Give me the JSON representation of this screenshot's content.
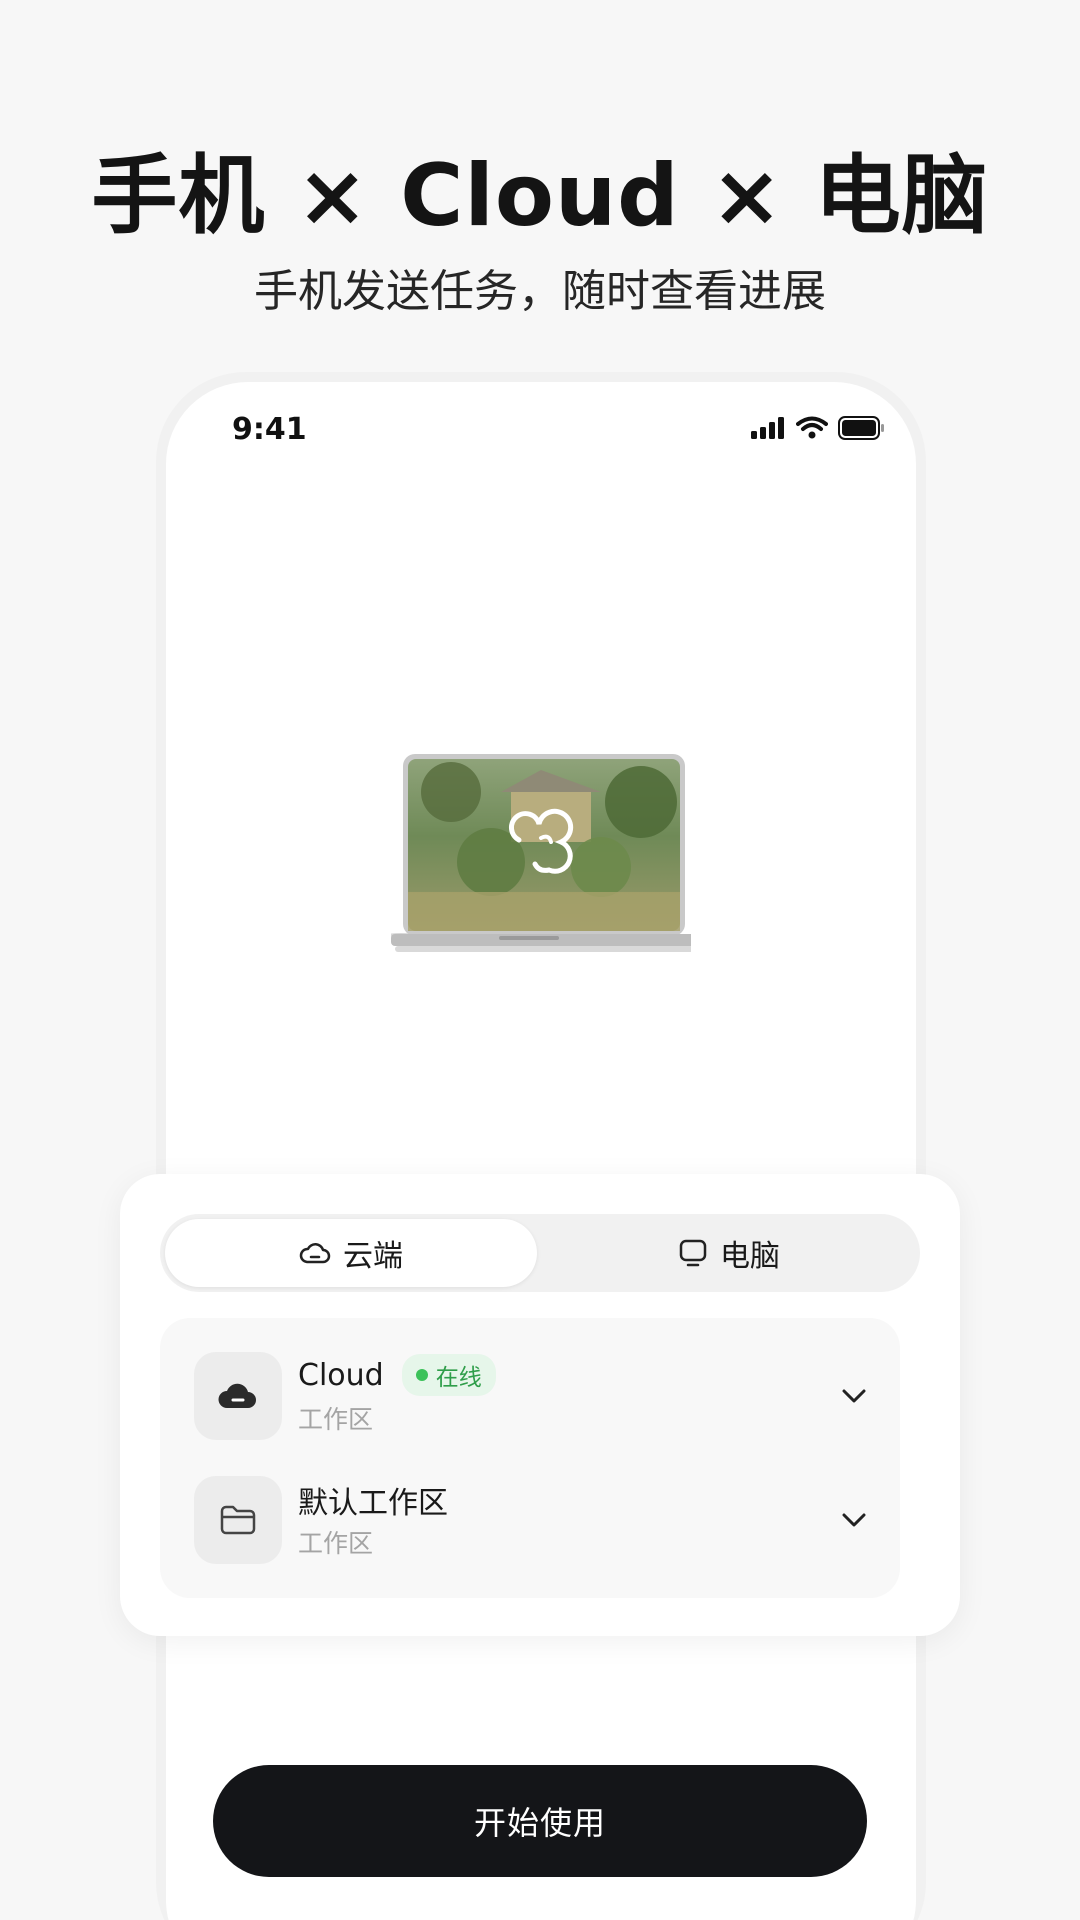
{
  "hero": {
    "title": "手机 × Cloud × 电脑",
    "subtitle": "手机发送任务，随时查看进展"
  },
  "status_bar": {
    "time": "9:41",
    "icons": [
      "signal-icon",
      "wifi-icon",
      "battery-icon"
    ]
  },
  "illustration": {
    "icon": "laptop-illustration"
  },
  "tabs": [
    {
      "label": "云端",
      "icon": "cloud-outline-icon",
      "active": true
    },
    {
      "label": "电脑",
      "icon": "monitor-icon",
      "active": false
    }
  ],
  "workspaces": [
    {
      "name": "Cloud",
      "status": "在线",
      "subtitle": "工作区",
      "icon": "cloud-filled-icon"
    },
    {
      "name": "默认工作区",
      "subtitle": "工作区",
      "icon": "folder-icon"
    }
  ],
  "start_button": {
    "label": "开始使用"
  },
  "colors": {
    "background": "#f7f7f7",
    "button": "#141518",
    "online_green": "#3cc25a"
  }
}
